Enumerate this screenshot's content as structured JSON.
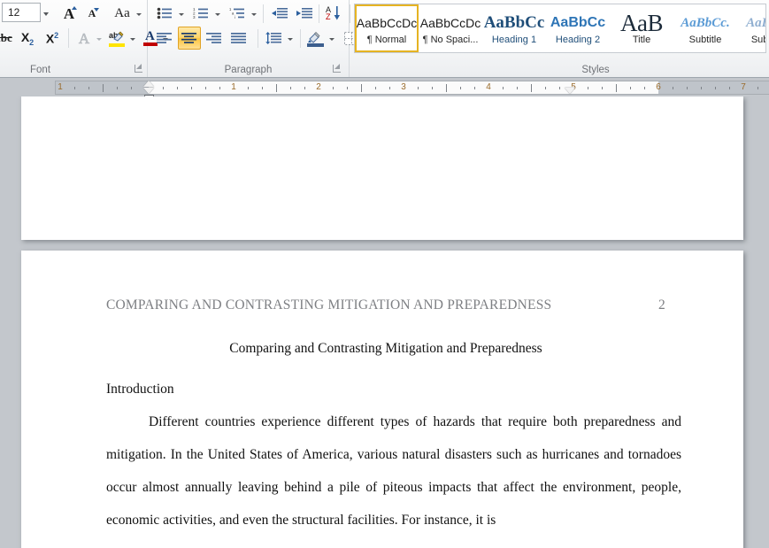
{
  "ribbon": {
    "font_group": {
      "label": "Font",
      "font_size_value": "12",
      "grow_font_label": "A",
      "shrink_font_label": "A",
      "change_case_label": "Aa",
      "clear_formatting_label": "Aa",
      "strikethrough_label": "abc",
      "subscript_label": "X",
      "subscript_sub": "2",
      "superscript_label": "X",
      "superscript_sup": "2",
      "text_effects_label": "A",
      "highlight_label": "ab",
      "font_color_label": "A",
      "dialog_launcher_name": "font-dialog-launcher"
    },
    "paragraph_group": {
      "label": "Paragraph",
      "bullets_label": "Bullets",
      "numbering_label": "Numbering",
      "multilevel_label": "Multilevel List",
      "decrease_indent_label": "Decrease Indent",
      "increase_indent_label": "Increase Indent",
      "sort_label": "Sort",
      "show_marks_label": "¶",
      "align_left_label": "Align Left",
      "align_center_label": "Center",
      "align_right_label": "Align Right",
      "justify_label": "Justify",
      "line_spacing_label": "Line and Paragraph Spacing",
      "shading_label": "Shading",
      "borders_label": "Borders",
      "dialog_launcher_name": "paragraph-dialog-launcher"
    },
    "styles_group": {
      "label": "Styles",
      "items": [
        {
          "preview": "AaBbCcDc",
          "name": "¶ Normal",
          "selected": true,
          "style": "normal"
        },
        {
          "preview": "AaBbCcDc",
          "name": "¶ No Spaci...",
          "selected": false,
          "style": "nospacing"
        },
        {
          "preview": "AaBbCс",
          "name": "Heading 1",
          "selected": false,
          "style": "heading1"
        },
        {
          "preview": "AaBbCc",
          "name": "Heading 2",
          "selected": false,
          "style": "heading2"
        },
        {
          "preview": "AaB",
          "name": "Title",
          "selected": false,
          "style": "title"
        },
        {
          "preview": "AaBbCc.",
          "name": "Subtitle",
          "selected": false,
          "style": "subtitle"
        },
        {
          "preview": "AaBbCc",
          "name": "Subtle...",
          "selected": false,
          "style": "subtle"
        }
      ]
    }
  },
  "ruler": {
    "numbers": [
      "1",
      "1",
      "2",
      "3",
      "4",
      "5",
      "6",
      "7"
    ],
    "left_indent_marker": "first-line-indent",
    "right_indent_marker": "right-indent"
  },
  "document": {
    "header_text": "COMPARING AND CONTRASTING MITIGATION AND PREPAREDNESS",
    "page_number": "2",
    "title": "Comparing and Contrasting Mitigation and Preparedness",
    "heading": "Introduction",
    "paragraph": "Different countries experience  different types of hazards that require both preparedness and mitigation. In the United States of America, various natural  disasters such as hurricanes  and tornadoes occur almost annually  leaving behind a pile of piteous impacts that affect the environment,  people,  economic  activities,  and even the structural  facilities.  For instance,  it is"
  },
  "colors": {
    "accent_gold": "#e6b422",
    "heading_blue": "#1f4e79",
    "ribbon_bg": "#f6f7f8",
    "canvas_bg": "#c3c7cc",
    "header_gray": "#7d7f83"
  }
}
